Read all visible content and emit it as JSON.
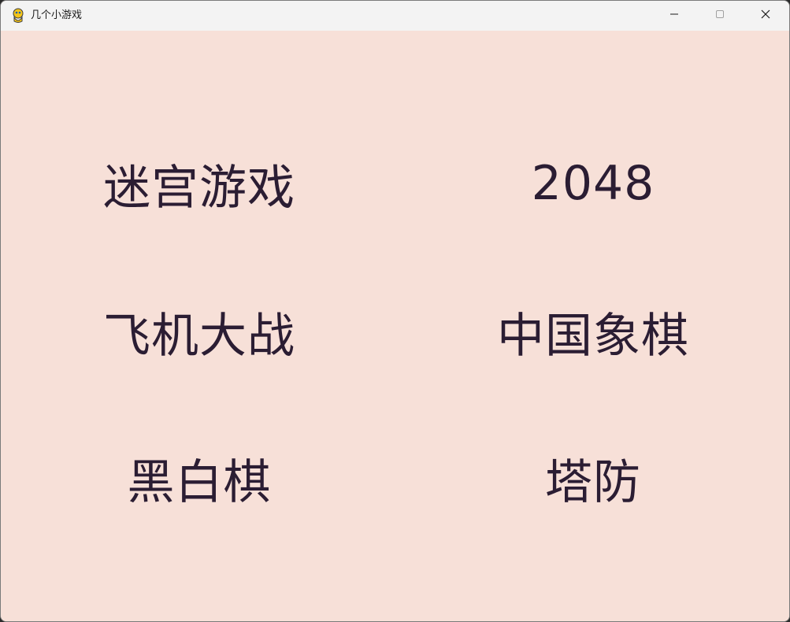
{
  "window": {
    "title": "几个小游戏",
    "icon": "pygame-snake-icon",
    "controls": {
      "minimize": "minimize-icon",
      "maximize": "maximize-icon",
      "close": "close-icon"
    }
  },
  "colors": {
    "background": "#f7e0d8",
    "text": "#2b1d33",
    "titlebar": "#f3f3f3"
  },
  "menu": {
    "items": [
      {
        "label": "迷宫游戏"
      },
      {
        "label": "2048"
      },
      {
        "label": "飞机大战"
      },
      {
        "label": "中国象棋"
      },
      {
        "label": "黑白棋"
      },
      {
        "label": "塔防"
      }
    ]
  }
}
